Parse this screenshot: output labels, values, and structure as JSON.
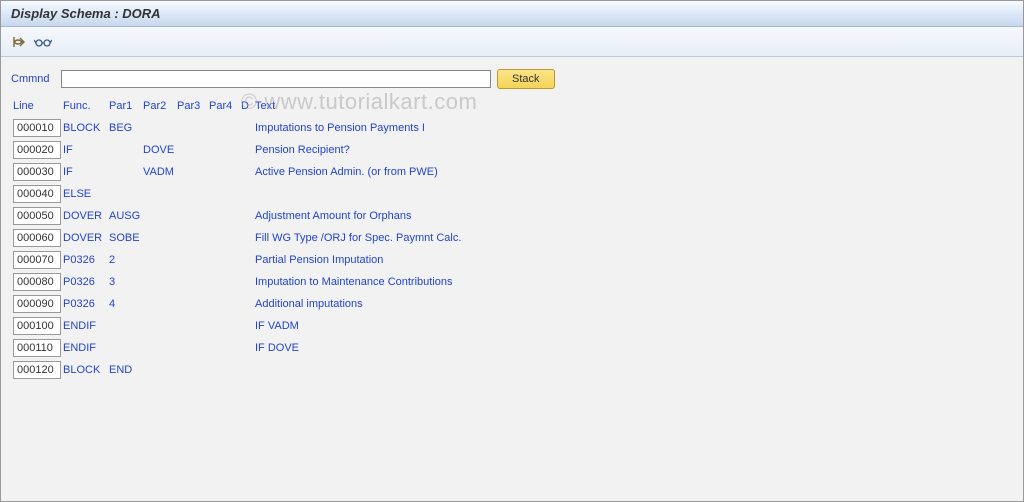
{
  "title": "Display Schema : DORA",
  "watermark": "© www.tutorialkart.com",
  "command": {
    "label": "Cmmnd",
    "value": "",
    "stack_label": "Stack"
  },
  "columns": {
    "line": "Line",
    "func": "Func.",
    "par1": "Par1",
    "par2": "Par2",
    "par3": "Par3",
    "par4": "Par4",
    "d": "D",
    "text": "Text"
  },
  "rows": [
    {
      "line": "000010",
      "func": "BLOCK",
      "par1": "BEG",
      "par2": "",
      "par3": "",
      "par4": "",
      "d": "",
      "text": "Imputations to Pension Payments I"
    },
    {
      "line": "000020",
      "func": "IF",
      "par1": "",
      "par2": "DOVE",
      "par3": "",
      "par4": "",
      "d": "",
      "text": "Pension Recipient?"
    },
    {
      "line": "000030",
      "func": "IF",
      "par1": "",
      "par2": "VADM",
      "par3": "",
      "par4": "",
      "d": "",
      "text": "Active Pension Admin. (or from PWE)"
    },
    {
      "line": "000040",
      "func": "ELSE",
      "par1": "",
      "par2": "",
      "par3": "",
      "par4": "",
      "d": "",
      "text": ""
    },
    {
      "line": "000050",
      "func": "DOVER",
      "par1": "AUSG",
      "par2": "",
      "par3": "",
      "par4": "",
      "d": "",
      "text": "Adjustment Amount for Orphans"
    },
    {
      "line": "000060",
      "func": "DOVER",
      "par1": "SOBE",
      "par2": "",
      "par3": "",
      "par4": "",
      "d": "",
      "text": "Fill WG Type /ORJ for Spec. Paymnt Calc."
    },
    {
      "line": "000070",
      "func": "P0326",
      "par1": "2",
      "par2": "",
      "par3": "",
      "par4": "",
      "d": "",
      "text": "Partial Pension Imputation"
    },
    {
      "line": "000080",
      "func": "P0326",
      "par1": "3",
      "par2": "",
      "par3": "",
      "par4": "",
      "d": "",
      "text": "Imputation to Maintenance Contributions"
    },
    {
      "line": "000090",
      "func": "P0326",
      "par1": "4",
      "par2": "",
      "par3": "",
      "par4": "",
      "d": "",
      "text": "Additional imputations"
    },
    {
      "line": "000100",
      "func": "ENDIF",
      "par1": "",
      "par2": "",
      "par3": "",
      "par4": "",
      "d": "",
      "text": "IF VADM"
    },
    {
      "line": "000110",
      "func": "ENDIF",
      "par1": "",
      "par2": "",
      "par3": "",
      "par4": "",
      "d": "",
      "text": "IF DOVE"
    },
    {
      "line": "000120",
      "func": "BLOCK",
      "par1": "END",
      "par2": "",
      "par3": "",
      "par4": "",
      "d": "",
      "text": ""
    }
  ]
}
